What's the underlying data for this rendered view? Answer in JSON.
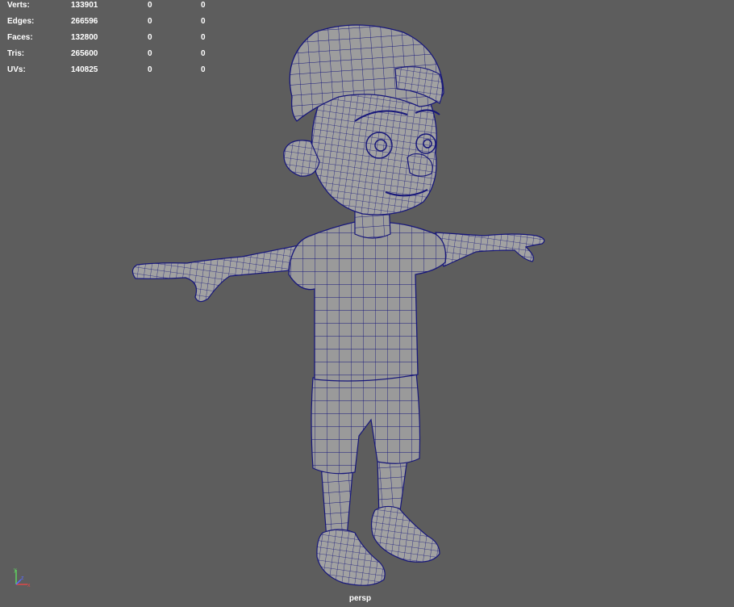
{
  "hud": {
    "rows": [
      {
        "label": "Verts:",
        "total": "133901",
        "selected": "0",
        "component": "0"
      },
      {
        "label": "Edges:",
        "total": "266596",
        "selected": "0",
        "component": "0"
      },
      {
        "label": "Faces:",
        "total": "132800",
        "selected": "0",
        "component": "0"
      },
      {
        "label": "Tris:",
        "total": "265600",
        "selected": "0",
        "component": "0"
      },
      {
        "label": "UVs:",
        "total": "140825",
        "selected": "0",
        "component": "0"
      }
    ]
  },
  "viewport": {
    "camera": "persp",
    "background": "#5d5d5d",
    "mesh_fill": "#9d9d9d",
    "wire_color": "#17177a",
    "axis": {
      "y": "y",
      "x": "x",
      "z": "z"
    }
  }
}
